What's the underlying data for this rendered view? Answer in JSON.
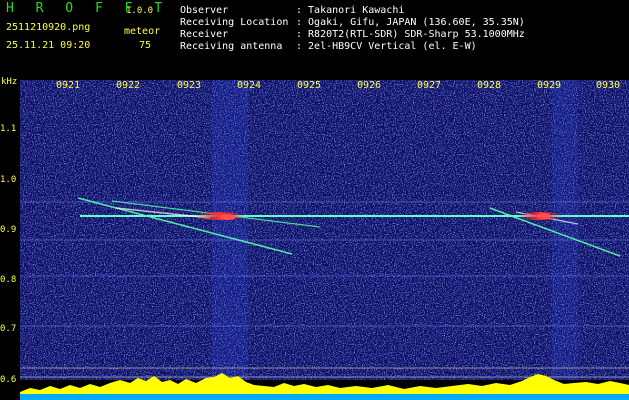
{
  "header": {
    "app_title": "H R O F F T",
    "version": "1.0.0",
    "filename": "2511210920.png",
    "datetime": "25.11.21 09:20",
    "meteor_label": "meteor",
    "meteor_count": "75",
    "fields": [
      {
        "label": "Observer",
        "value": ": Takanori Kawachi"
      },
      {
        "label": "Receiving Location",
        "value": ": Ogaki, Gifu, JAPAN (136.60E, 35.35N)"
      },
      {
        "label": "Receiver",
        "value": ": R820T2(RTL-SDR) SDR-Sharp 53.1000MHz"
      },
      {
        "label": "Receiving antenna",
        "value": ": 2el-HB9CV Vertical (el. E-W)"
      }
    ]
  },
  "axis": {
    "unit": "kHz",
    "y_ticks": [
      "1.1",
      "1.0",
      "0.9",
      "0.8",
      "0.7",
      "0.6"
    ],
    "x_ticks": [
      "0921",
      "0922",
      "0923",
      "0924",
      "0925",
      "0926",
      "0927",
      "0928",
      "0929",
      "0930"
    ]
  },
  "colors": {
    "background": "#000000",
    "plot_bg": "#0a0f6a",
    "trace": "#66ffcc",
    "meteor_head": "#ff3030",
    "activity_bar": "#ffff00",
    "baseline": "#00aaff"
  }
}
